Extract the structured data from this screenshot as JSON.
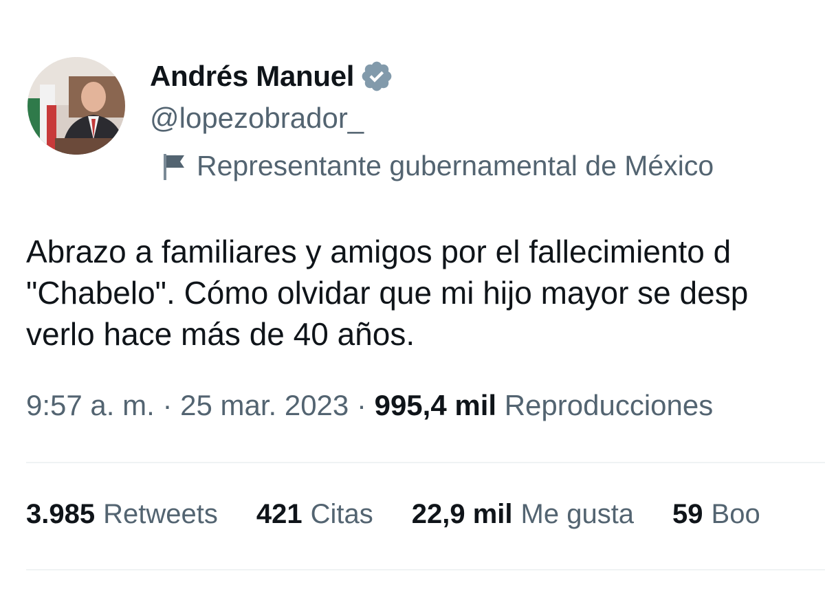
{
  "author": {
    "display_name": "Andrés Manuel",
    "handle": "@lopezobrador_",
    "verified_icon": "verified-badge-icon",
    "label_icon": "flag-icon",
    "label": "Representante gubernamental de México"
  },
  "tweet": {
    "lines": [
      "Abrazo a familiares y amigos por el fallecimiento d",
      "\"Chabelo\". Cómo olvidar que mi hijo mayor se desp",
      "verlo hace más de 40 años."
    ]
  },
  "meta": {
    "time": "9:57 a. m.",
    "separator": "·",
    "date": "25 mar. 2023",
    "views_count": "995,4 mil",
    "views_label": "Reproducciones"
  },
  "stats": [
    {
      "count": "3.985",
      "label": "Retweets"
    },
    {
      "count": "421",
      "label": "Citas"
    },
    {
      "count": "22,9 mil",
      "label": "Me gusta"
    },
    {
      "count": "59",
      "label": "Boo"
    }
  ],
  "colors": {
    "text": "#0f1419",
    "secondary": "#536471",
    "verified_badge": "#829aab",
    "divider": "#eff3f4"
  }
}
